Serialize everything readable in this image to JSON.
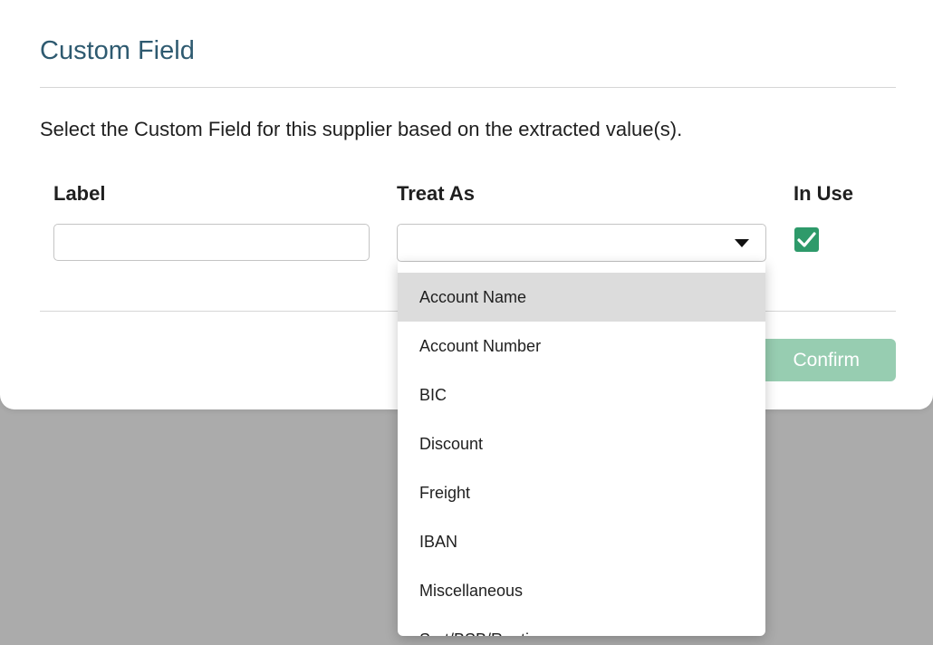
{
  "dialog": {
    "title": "Custom Field",
    "description": "Select the Custom Field for this supplier based on the extracted value(s).",
    "columns": {
      "label": "Label",
      "treat_as": "Treat As",
      "in_use": "In Use"
    },
    "label_input": {
      "value": "",
      "placeholder": ""
    },
    "treat_as_select": {
      "selected": "",
      "open": true
    },
    "in_use_checked": true,
    "confirm_label": "Confirm"
  },
  "dropdown": {
    "highlighted_index": 0,
    "options": [
      {
        "label": "Account Name"
      },
      {
        "label": "Account Number"
      },
      {
        "label": "BIC"
      },
      {
        "label": "Discount"
      },
      {
        "label": "Freight"
      },
      {
        "label": "IBAN"
      },
      {
        "label": "Miscellaneous"
      },
      {
        "label": "Sort/BSB/Routi..."
      }
    ]
  },
  "colors": {
    "title": "#2e5a70",
    "checkbox": "#2e9a6a",
    "confirm_button": "#97cdb1",
    "highlight": "#dcdcdc",
    "backdrop": "#ababab"
  },
  "icons": {
    "dropdown_caret": "caret-down-icon",
    "checkbox": "checkmark-icon"
  }
}
